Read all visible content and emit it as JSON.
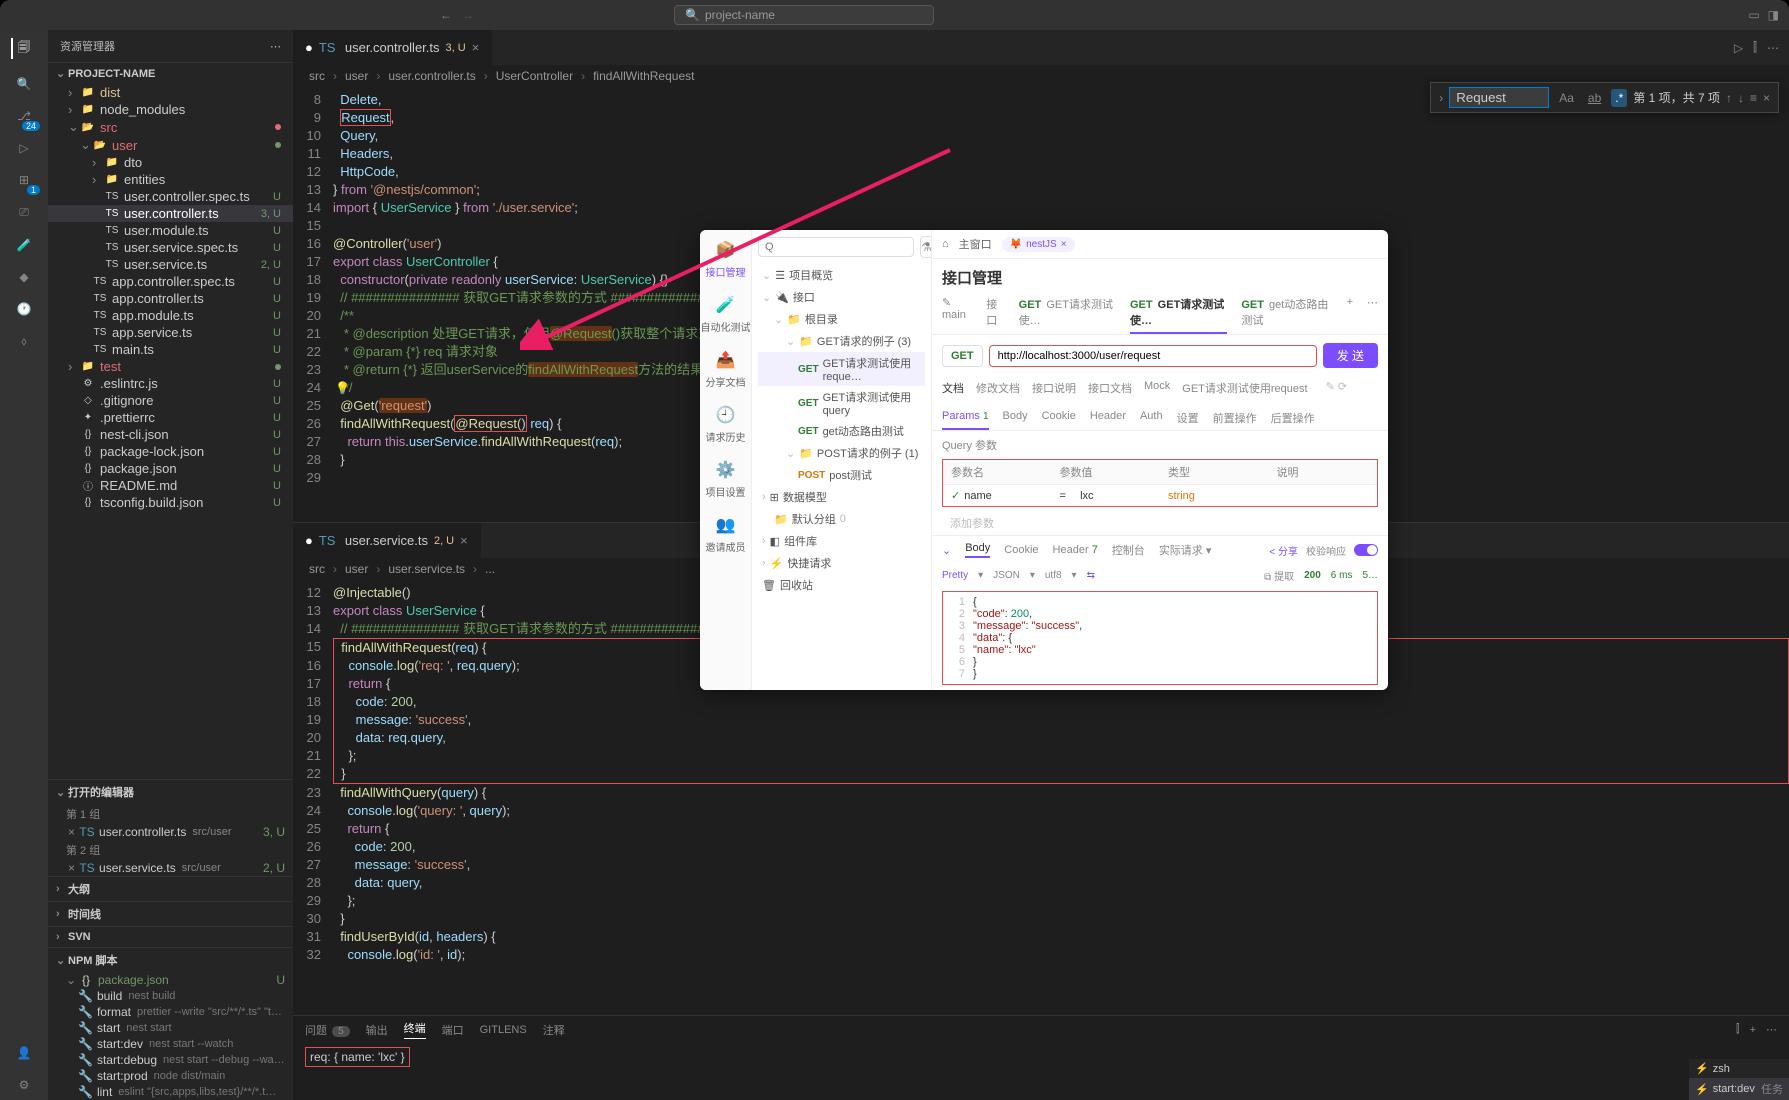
{
  "titlebar": {
    "project": "project-name"
  },
  "activitybar": {
    "badge_scm": "24",
    "badge_ext": "1"
  },
  "sidebar": {
    "title": "资源管理器",
    "project": "PROJECT-NAME",
    "tree": [
      {
        "ind": 1,
        "chev": "›",
        "ico": "📁",
        "name": "dist",
        "cls": "c-dist"
      },
      {
        "ind": 1,
        "chev": "›",
        "ico": "📁",
        "name": "node_modules"
      },
      {
        "ind": 1,
        "chev": "⌄",
        "ico": "📂",
        "name": "src",
        "cls": "c-src",
        "dot": "#e06c75"
      },
      {
        "ind": 2,
        "chev": "⌄",
        "ico": "📂",
        "name": "user",
        "cls": "c-src",
        "dot": "#719867"
      },
      {
        "ind": 3,
        "chev": "›",
        "ico": "📁",
        "name": "dto"
      },
      {
        "ind": 3,
        "chev": "›",
        "ico": "📁",
        "name": "entities"
      },
      {
        "ind": 3,
        "chev": "",
        "ico": "TS",
        "name": "user.controller.spec.ts",
        "git": "U"
      },
      {
        "ind": 3,
        "chev": "",
        "ico": "TS",
        "name": "user.controller.ts",
        "git": "3, U",
        "sel": true
      },
      {
        "ind": 3,
        "chev": "",
        "ico": "TS",
        "name": "user.module.ts",
        "git": "U"
      },
      {
        "ind": 3,
        "chev": "",
        "ico": "TS",
        "name": "user.service.spec.ts",
        "git": "U"
      },
      {
        "ind": 3,
        "chev": "",
        "ico": "TS",
        "name": "user.service.ts",
        "git": "2, U"
      },
      {
        "ind": 2,
        "chev": "",
        "ico": "TS",
        "name": "app.controller.spec.ts",
        "git": "U"
      },
      {
        "ind": 2,
        "chev": "",
        "ico": "TS",
        "name": "app.controller.ts",
        "git": "U"
      },
      {
        "ind": 2,
        "chev": "",
        "ico": "TS",
        "name": "app.module.ts",
        "git": "U"
      },
      {
        "ind": 2,
        "chev": "",
        "ico": "TS",
        "name": "app.service.ts",
        "git": "U"
      },
      {
        "ind": 2,
        "chev": "",
        "ico": "TS",
        "name": "main.ts",
        "git": "U"
      },
      {
        "ind": 1,
        "chev": "›",
        "ico": "📁",
        "name": "test",
        "cls": "c-src",
        "dot": "#719867"
      },
      {
        "ind": 1,
        "chev": "",
        "ico": "⚙",
        "name": ".eslintrc.js",
        "git": "U"
      },
      {
        "ind": 1,
        "chev": "",
        "ico": "◇",
        "name": ".gitignore",
        "git": "U"
      },
      {
        "ind": 1,
        "chev": "",
        "ico": "✦",
        "name": ".prettierrc",
        "git": "U"
      },
      {
        "ind": 1,
        "chev": "",
        "ico": "{}",
        "name": "nest-cli.json",
        "git": "U"
      },
      {
        "ind": 1,
        "chev": "",
        "ico": "{}",
        "name": "package-lock.json",
        "git": "U"
      },
      {
        "ind": 1,
        "chev": "",
        "ico": "{}",
        "name": "package.json",
        "git": "U"
      },
      {
        "ind": 1,
        "chev": "",
        "ico": "ⓘ",
        "name": "README.md",
        "git": "U"
      },
      {
        "ind": 1,
        "chev": "",
        "ico": "{}",
        "name": "tsconfig.build.json",
        "git": "U"
      }
    ],
    "openeditors_label": "打开的编辑器",
    "group1": "第 1 组",
    "group2": "第 2 组",
    "oe1": {
      "name": "user.controller.ts",
      "path": "src/user",
      "git": "3, U"
    },
    "oe2": {
      "name": "user.service.ts",
      "path": "src/user",
      "git": "2, U"
    },
    "outline": "大纲",
    "timeline": "时间线",
    "svn": "SVN",
    "npm": "NPM 脚本",
    "npm_pkg": "package.json",
    "npm_scripts": [
      {
        "name": "build",
        "desc": "nest build"
      },
      {
        "name": "format",
        "desc": "prettier --write \"src/**/*.ts\" \"t…"
      },
      {
        "name": "start",
        "desc": "nest start"
      },
      {
        "name": "start:dev",
        "desc": "nest start --watch"
      },
      {
        "name": "start:debug",
        "desc": "nest start --debug --wa…"
      },
      {
        "name": "start:prod",
        "desc": "node dist/main"
      },
      {
        "name": "lint",
        "desc": "eslint \"{src,apps,libs,test}/**/*.t…"
      }
    ]
  },
  "editor1": {
    "tab": "user.controller.ts",
    "tab_mod": "3, U",
    "breadcrumb": [
      "src",
      "user",
      "user.controller.ts",
      "UserController",
      "findAllWithRequest"
    ],
    "lines": [
      {
        "n": 8,
        "html": "  <span class='var'>Delete</span>,"
      },
      {
        "n": 9,
        "html": "  <span class='var redbox'>Request</span>,",
        "boxed": true
      },
      {
        "n": 10,
        "html": "  <span class='var'>Query</span>,"
      },
      {
        "n": 11,
        "html": "  <span class='var'>Headers</span>,"
      },
      {
        "n": 12,
        "html": "  <span class='var'>HttpCode</span>,"
      },
      {
        "n": 13,
        "html": "} <span class='kw'>from</span> <span class='str'>'@nestjs/common'</span>;"
      },
      {
        "n": 14,
        "html": "<span class='kw'>import</span> { <span class='cls'>UserService</span> } <span class='kw'>from</span> <span class='str'>'./user.service'</span>;"
      },
      {
        "n": 15,
        "html": ""
      },
      {
        "n": 16,
        "html": "<span class='dec'>@Controller</span>(<span class='str'>'user'</span>)"
      },
      {
        "n": 17,
        "html": "<span class='kw'>export class</span> <span class='cls'>UserController</span> {"
      },
      {
        "n": 18,
        "html": "  <span class='kw'>constructor</span>(<span class='kw'>private readonly</span> <span class='var'>userService</span>: <span class='cls'>UserService</span>) {}"
      },
      {
        "n": 19,
        "html": "  <span class='cmt'>// ############### 获取GET请求参数的方式 #####################</span>"
      },
      {
        "n": 20,
        "html": "  <span class='cmt'>/**</span>"
      },
      {
        "n": 21,
        "html": "  <span class='cmt'> * @description 处理GET请求，使用<span class='hl'>@Request</span>()获取整个请求对象</span>"
      },
      {
        "n": 22,
        "html": "  <span class='cmt'> * @param {*} req 请求对象</span>"
      },
      {
        "n": 23,
        "html": "  <span class='cmt'> * @return {*} 返回userService的<span class='hl'>findAllWithRequest</span>方法的结果</span>"
      },
      {
        "n": 24,
        "html": "  <span class='cmt'> */</span>",
        "bulb": true
      },
      {
        "n": 25,
        "html": "  <span class='dec'>@Get</span>(<span class='str hl'>'request'</span>)"
      },
      {
        "n": 26,
        "html": "  <span class='fn'>findAllWithRequest</span>(<span class='redbox'><span class='dec'>@Request</span>()</span> <span class='var'>req</span>) {"
      },
      {
        "n": 27,
        "html": "    <span class='kw'>return</span> <span class='kw'>this</span>.<span class='var'>userService</span>.<span class='fn'>findAllWithRequest</span>(<span class='var'>req</span>);"
      },
      {
        "n": 28,
        "html": "  }"
      },
      {
        "n": 29,
        "html": ""
      }
    ]
  },
  "editor2": {
    "tab": "user.service.ts",
    "tab_mod": "2, U",
    "breadcrumb": [
      "src",
      "user",
      "user.service.ts",
      "..."
    ],
    "lines": [
      {
        "n": 12,
        "html": "<span class='dec'>@Injectable</span>()"
      },
      {
        "n": 13,
        "html": "<span class='kw'>export class</span> <span class='cls'>UserService</span> {"
      },
      {
        "n": 14,
        "html": "  <span class='cmt'>// ############### 获取GET请求参数的方式 #####################</span>"
      },
      {
        "n": 15,
        "html": "  <span class='fn'>findAllWithRequest</span>(<span class='var'>req</span>) {",
        "boxtop": true
      },
      {
        "n": 16,
        "html": "    <span class='var'>console</span>.<span class='fn'>log</span>(<span class='str'>'req: '</span>, <span class='var'>req</span>.<span class='var'>query</span>);"
      },
      {
        "n": 17,
        "html": "    <span class='kw'>return</span> {"
      },
      {
        "n": 18,
        "html": "      <span class='var'>code</span>: <span class='num'>200</span>,"
      },
      {
        "n": 19,
        "html": "      <span class='var'>message</span>: <span class='str'>'success'</span>,"
      },
      {
        "n": 20,
        "html": "      <span class='var'>data</span>: <span class='var'>req</span>.<span class='var'>query</span>,"
      },
      {
        "n": 21,
        "html": "    };"
      },
      {
        "n": 22,
        "html": "  }",
        "boxbot": true
      },
      {
        "n": 23,
        "html": "  <span class='fn'>findAllWithQuery</span>(<span class='var'>query</span>) {"
      },
      {
        "n": 24,
        "html": "    <span class='var'>console</span>.<span class='fn'>log</span>(<span class='str'>'query: '</span>, <span class='var'>query</span>);"
      },
      {
        "n": 25,
        "html": "    <span class='kw'>return</span> {"
      },
      {
        "n": 26,
        "html": "      <span class='var'>code</span>: <span class='num'>200</span>,"
      },
      {
        "n": 27,
        "html": "      <span class='var'>message</span>: <span class='str'>'success'</span>,"
      },
      {
        "n": 28,
        "html": "      <span class='var'>data</span>: <span class='var'>query</span>,"
      },
      {
        "n": 29,
        "html": "    };"
      },
      {
        "n": 30,
        "html": "  }"
      },
      {
        "n": 31,
        "html": "  <span class='fn'>findUserById</span>(<span class='var'>id</span>, <span class='var'>headers</span>) {"
      },
      {
        "n": 32,
        "html": "    <span class='var'>console</span>.<span class='fn'>log</span>(<span class='str'>'id: '</span>, <span class='var'>id</span>);"
      }
    ]
  },
  "find": {
    "value": "Request",
    "result": "第 1 项，共 7 项"
  },
  "terminal": {
    "tabs": [
      "问题",
      "输出",
      "终端",
      "端口",
      "GITLENS",
      "注释"
    ],
    "problems_count": "5",
    "output": "req:  { name: 'lxc' }",
    "side": [
      {
        "ico": "⚡",
        "label": "zsh"
      },
      {
        "ico": "⚡",
        "label": "start:dev",
        "extra": "任务",
        "act": true
      }
    ]
  },
  "apitool": {
    "topbar": {
      "home": "主窗口",
      "pill": "nestJS"
    },
    "rail": [
      {
        "ico": "📦",
        "label": "接口管理",
        "act": true
      },
      {
        "ico": "🧪",
        "label": "自动化测试"
      },
      {
        "ico": "📤",
        "label": "分享文档"
      },
      {
        "ico": "🕘",
        "label": "请求历史"
      },
      {
        "ico": "⚙️",
        "label": "项目设置"
      },
      {
        "ico": "👥",
        "label": "邀请成员"
      }
    ],
    "title": "接口管理",
    "subtabs": [
      {
        "pre": "",
        "label": "接口",
        "act": false
      },
      {
        "pre": "GET",
        "label": "GET请求测试使…",
        "m": "get"
      },
      {
        "pre": "GET",
        "label": "GET请求测试使…",
        "m": "get",
        "act": true
      },
      {
        "pre": "GET",
        "label": "get动态路由测试",
        "m": "get"
      }
    ],
    "subtabs_left": "✎ main",
    "sidebar": {
      "items": [
        {
          "chev": "⌄",
          "label": "项目概览",
          "ico": "☰"
        },
        {
          "chev": "⌄",
          "label": "接口",
          "ico": "🔌"
        },
        {
          "chev": "⌄",
          "label": "根目录",
          "ind": 1,
          "ico": "📁"
        },
        {
          "chev": "⌄",
          "label": "GET请求的例子 (3)",
          "ind": 2,
          "ico": "📁"
        },
        {
          "pre": "GET",
          "label": "GET请求测试使用reque…",
          "ind": 3,
          "m": "get",
          "sel": true
        },
        {
          "pre": "GET",
          "label": "GET请求测试使用query",
          "ind": 3,
          "m": "get"
        },
        {
          "pre": "GET",
          "label": "get动态路由测试",
          "ind": 3,
          "m": "get"
        },
        {
          "chev": "⌄",
          "label": "POST请求的例子 (1)",
          "ind": 2,
          "ico": "📁"
        },
        {
          "pre": "POST",
          "label": "post测试",
          "ind": 3,
          "m": "post"
        },
        {
          "chev": "›",
          "label": "数据模型",
          "ico": "⊞"
        },
        {
          "chev": "",
          "label": "默认分组",
          "ind": 1,
          "ico": "📁",
          "cnt": "0"
        },
        {
          "chev": "›",
          "label": "组件库",
          "ico": "◧"
        },
        {
          "chev": "›",
          "label": "快捷请求",
          "ico": "⚡"
        },
        {
          "chev": "",
          "label": "回收站",
          "ico": "🗑"
        }
      ]
    },
    "url": {
      "method": "GET",
      "value": "http://localhost:3000/user/request",
      "send": "发 送"
    },
    "doc_tabs": [
      "文档",
      "修改文档",
      "接口说明",
      "接口文档",
      "Mock",
      "GET请求测试使用request"
    ],
    "param_tabs": [
      {
        "label": "Params",
        "badge": "1",
        "act": true
      },
      {
        "label": "Body"
      },
      {
        "label": "Cookie"
      },
      {
        "label": "Header"
      },
      {
        "label": "Auth"
      },
      {
        "label": "设置"
      },
      {
        "label": "前置操作"
      },
      {
        "label": "后置操作"
      }
    ],
    "query_label": "Query 参数",
    "table": {
      "hdr": [
        "参数名",
        "参数值",
        "类型",
        "说明"
      ],
      "row": {
        "name": "name",
        "eq": "=",
        "value": "lxc",
        "type": "string",
        "desc": ""
      },
      "add": "添加参数"
    },
    "resp_tabs": [
      {
        "label": "Body",
        "act": true
      },
      {
        "label": "Cookie"
      },
      {
        "label": "Header",
        "badge": "7"
      },
      {
        "label": "控制台"
      },
      {
        "label": "实际请求 ▾"
      }
    ],
    "resp_right": {
      "share": "< 分享",
      "status": "200",
      "time": "6 ms",
      "size": "5…",
      "verify": "校验响应"
    },
    "pretty": {
      "mode": "Pretty",
      "fmt": "JSON",
      "enc": "utf8",
      "copy": "⧉ 提取"
    },
    "json": [
      {
        "n": 1,
        "t": "{"
      },
      {
        "n": 2,
        "t": "    <span class='jk'>\"code\"</span>: <span class='jn'>200</span>,"
      },
      {
        "n": 3,
        "t": "    <span class='jk'>\"message\"</span>: <span class='js'>\"success\"</span>,"
      },
      {
        "n": 4,
        "t": "    <span class='jk'>\"data\"</span>: {"
      },
      {
        "n": 5,
        "t": "        <span class='jk'>\"name\"</span>: <span class='js'>\"lxc\"</span>"
      },
      {
        "n": 6,
        "t": "    }"
      },
      {
        "n": 7,
        "t": "}"
      }
    ]
  }
}
